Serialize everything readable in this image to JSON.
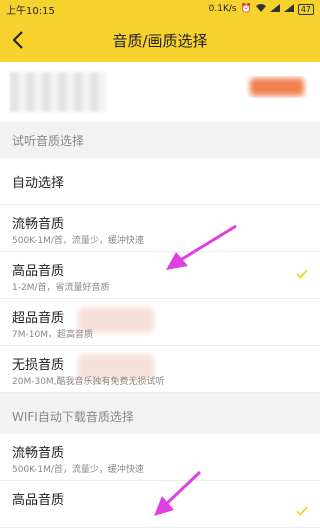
{
  "status_bar": {
    "time": "上午10:15",
    "network_speed": "0.1K/s",
    "battery": "47"
  },
  "header": {
    "title": "音质/画质选择",
    "back_icon": "chevron-left-icon"
  },
  "colors": {
    "header_bg": "#f7d22e",
    "check": "#f7d22e",
    "arrow": "#e040e0",
    "badge": "#f08050"
  },
  "trial_section": {
    "label": "试听音质选择",
    "items": [
      {
        "title": "自动选择",
        "subtitle": "",
        "checked": false
      },
      {
        "title": "流畅音质",
        "subtitle": "500K-1M/首，流量少，缓冲快速",
        "checked": false
      },
      {
        "title": "高品音质",
        "subtitle": "1-2M/首，省流量好音质",
        "checked": true
      },
      {
        "title": "超品音质",
        "subtitle": "7M-10M，超高音质",
        "checked": false
      },
      {
        "title": "无损音质",
        "subtitle": "20M-30M,酷我音乐独有免费无损试听",
        "checked": false
      }
    ]
  },
  "wifi_section": {
    "label": "WIFI自动下载音质选择",
    "items": [
      {
        "title": "流畅音质",
        "subtitle": "500K-1M/首，流量少，缓冲快速",
        "checked": false
      },
      {
        "title": "高品音质",
        "subtitle": "",
        "checked": true
      }
    ]
  }
}
